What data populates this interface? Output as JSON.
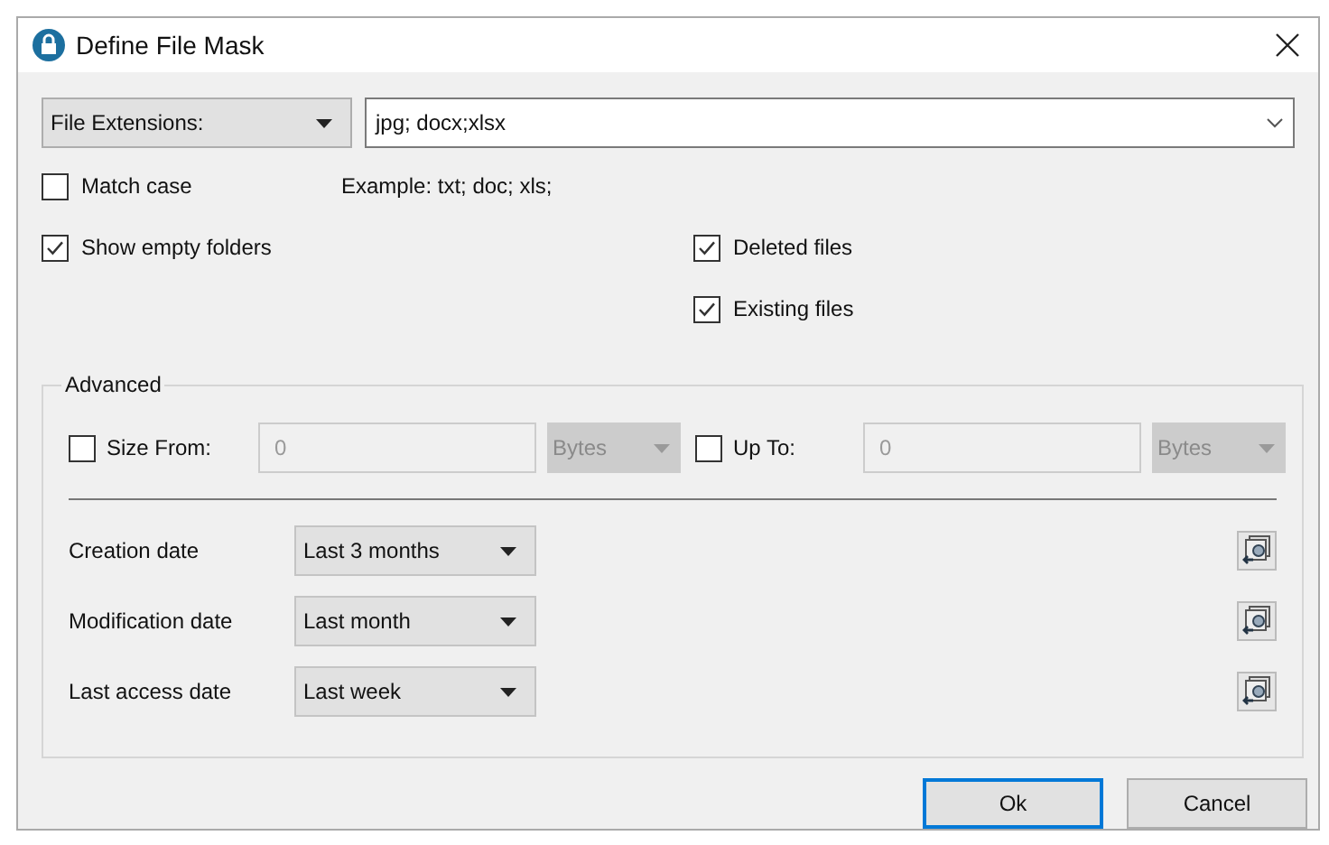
{
  "window": {
    "title": "Define File Mask"
  },
  "mask": {
    "type": "File Extensions:",
    "value": "jpg; docx;xlsx",
    "example": "Example: txt; doc; xls;"
  },
  "options": [
    {
      "label": "Match case",
      "checked": false
    },
    {
      "label": "Show empty folders",
      "checked": true
    }
  ],
  "file_states": [
    {
      "label": "Deleted files",
      "checked": true
    },
    {
      "label": "Existing files",
      "checked": true
    }
  ],
  "advanced": {
    "title": "Advanced",
    "size_filters": [
      {
        "label": "Size From:",
        "checked": false,
        "value": "0",
        "unit": "Bytes"
      },
      {
        "label": "Up To:",
        "checked": false,
        "value": "0",
        "unit": "Bytes"
      }
    ],
    "dates": [
      {
        "label": "Creation date",
        "value": "Last 3 months"
      },
      {
        "label": "Modification date",
        "value": "Last month"
      },
      {
        "label": "Last access date",
        "value": "Last week"
      }
    ]
  },
  "buttons": [
    {
      "label": "Ok",
      "default": true
    },
    {
      "label": "Cancel",
      "default": false
    }
  ]
}
